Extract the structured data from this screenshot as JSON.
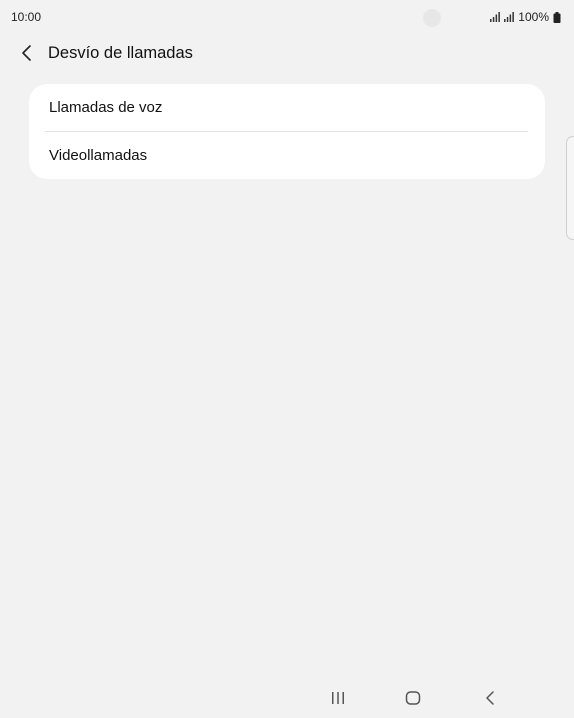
{
  "status_bar": {
    "time": "10:00",
    "battery_text": "100%",
    "icons": [
      "signal-icon",
      "signal-icon",
      "battery-icon"
    ]
  },
  "header": {
    "title": "Desvío de llamadas",
    "back_icon": "chevron-left-icon"
  },
  "list": {
    "items": [
      {
        "label": "Llamadas de voz"
      },
      {
        "label": "Videollamadas"
      }
    ]
  },
  "nav_bar": {
    "icons": [
      "recents-icon",
      "home-icon",
      "back-icon"
    ]
  }
}
